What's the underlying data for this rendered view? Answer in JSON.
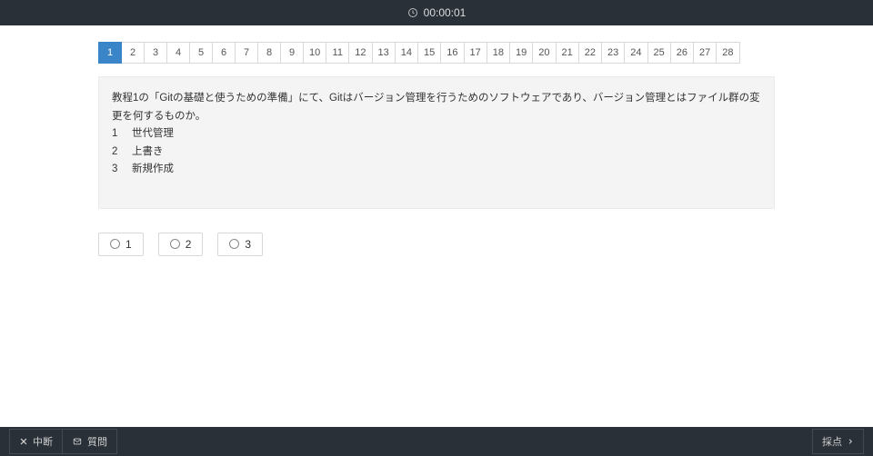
{
  "timer": "00:00:01",
  "pager": {
    "active": 1,
    "items": [
      "1",
      "2",
      "3",
      "4",
      "5",
      "6",
      "7",
      "8",
      "9",
      "10",
      "11",
      "12",
      "13",
      "14",
      "15",
      "16",
      "17",
      "18",
      "19",
      "20",
      "21",
      "22",
      "23",
      "24",
      "25",
      "26",
      "27",
      "28"
    ]
  },
  "question": {
    "prompt": "教程1の「Gitの基礎と使うための準備」にて、Gitはバージョン管理を行うためのソフトウェアであり、バージョン管理とはファイル群の変更を何するものか。",
    "choices": [
      {
        "num": "1",
        "text": "世代管理"
      },
      {
        "num": "2",
        "text": "上書き"
      },
      {
        "num": "3",
        "text": "新規作成"
      }
    ]
  },
  "answers": [
    {
      "label": "1"
    },
    {
      "label": "2"
    },
    {
      "label": "3"
    }
  ],
  "footer": {
    "abort": "中断",
    "inquiry": "質問",
    "grade": "採点"
  }
}
